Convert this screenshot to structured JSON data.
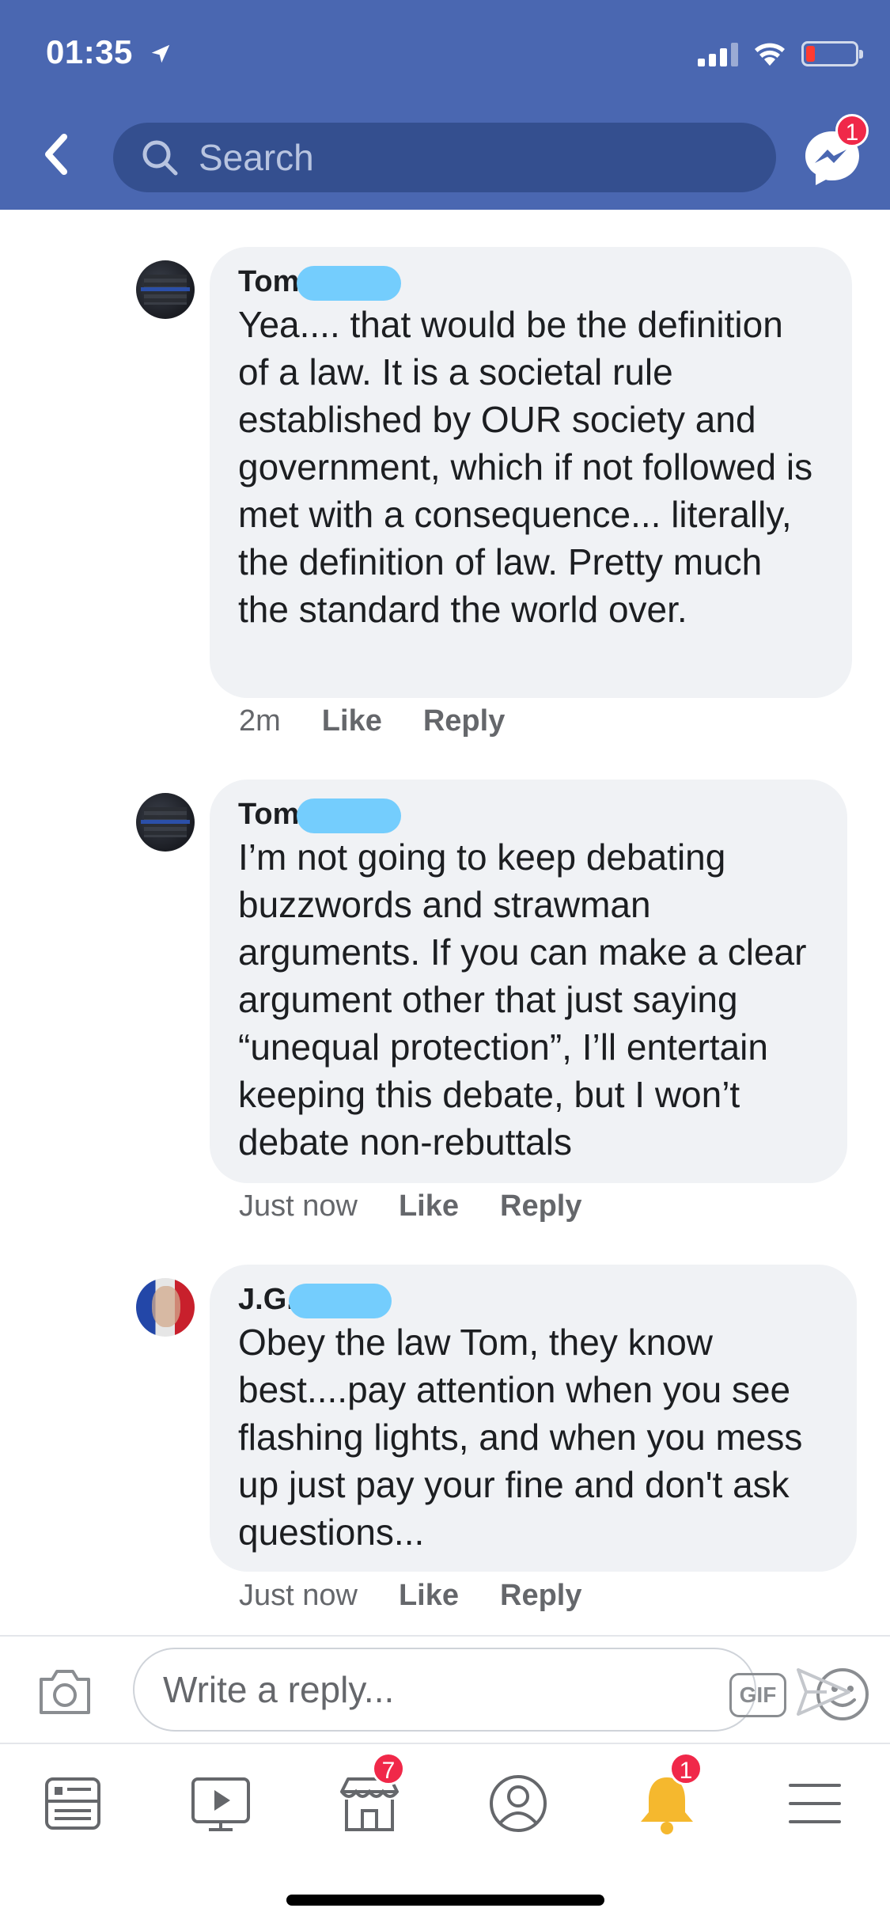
{
  "status_bar": {
    "time": "01:35"
  },
  "header": {
    "search_placeholder": "Search",
    "messenger_badge": "1"
  },
  "comments": [
    {
      "author": "Tom",
      "text": "Yea.... that would be the definition of a law. It is a societal rule established by OUR society and government, which if not followed is met with a consequence... literally, the definition of law. Pretty much the standard the world over.",
      "time": "2m",
      "like_label": "Like",
      "reply_label": "Reply"
    },
    {
      "author": "Tom",
      "text": "I’m not going to keep debating buzzwords and strawman arguments. If you can make a clear argument other that just saying “unequal protection”, I’ll entertain keeping this debate, but I won’t debate non-rebuttals",
      "time": "Just now",
      "like_label": "Like",
      "reply_label": "Reply"
    },
    {
      "author": "J.G.",
      "text": "Obey the law Tom, they know best....pay attention when you see flashing lights, and when you mess up just pay your fine and don't ask questions...",
      "time": "Just now",
      "like_label": "Like",
      "reply_label": "Reply"
    }
  ],
  "composer": {
    "placeholder": "Write a reply...",
    "gif_label": "GIF"
  },
  "tabbar": {
    "marketplace_badge": "7",
    "notifications_badge": "1"
  },
  "colors": {
    "header_bg": "#4a67b1",
    "bubble_bg": "#f0f2f5",
    "badge": "#f02849",
    "redaction": "#74cdfd"
  }
}
